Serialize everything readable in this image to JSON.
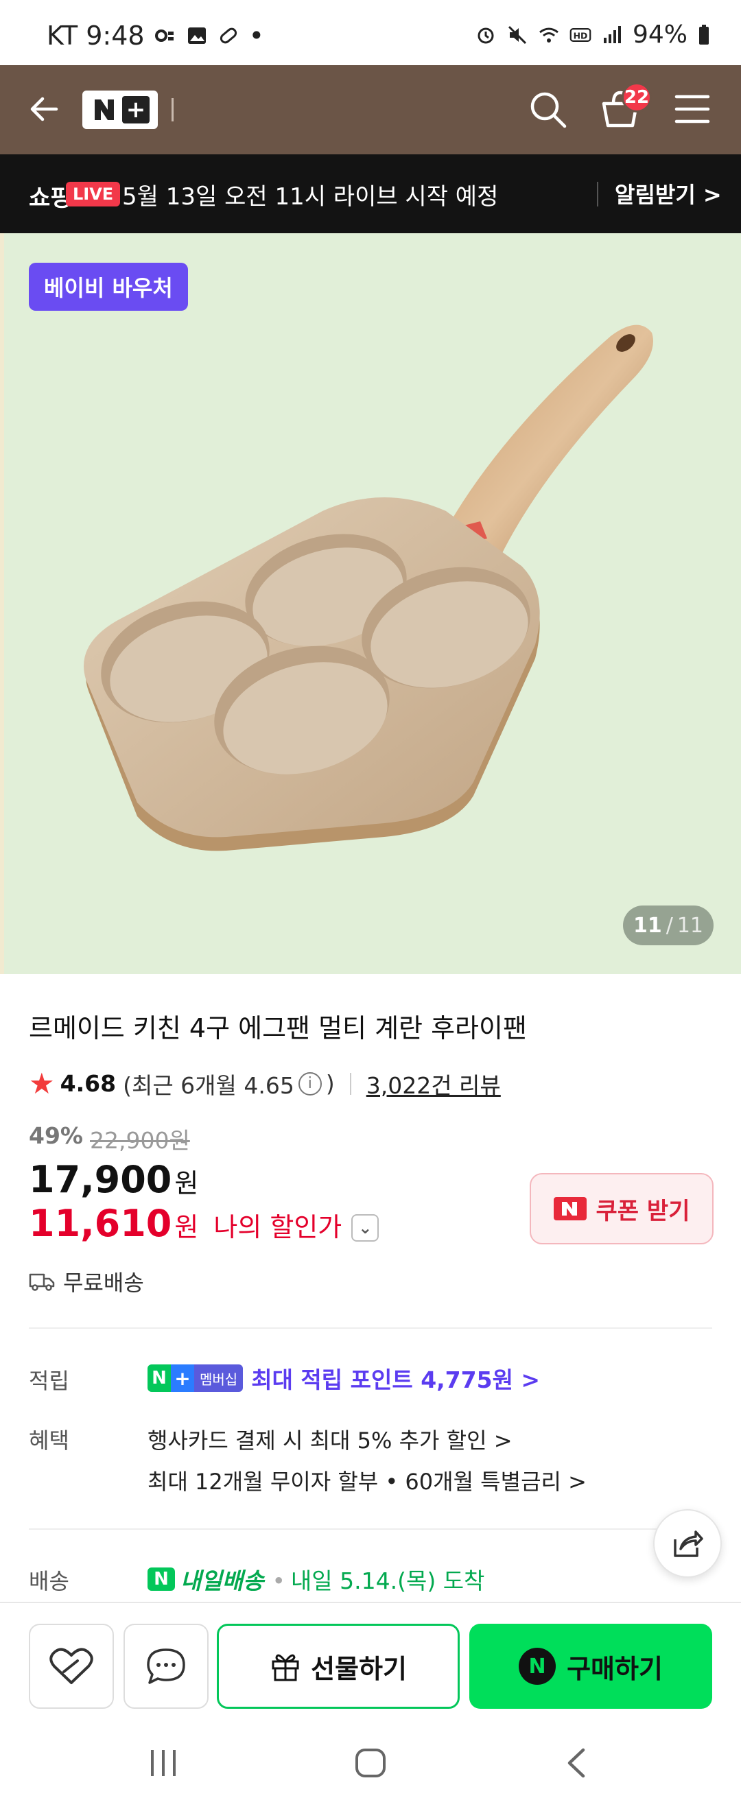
{
  "status_bar": {
    "carrier_time": "KT 9:48",
    "dot": "•",
    "battery": "94%"
  },
  "header": {
    "cart_count": "22"
  },
  "live_banner": {
    "shop_label": "쇼핑",
    "live_badge": "LIVE",
    "message": "5월 13일 오전 11시 라이브 시작 예정",
    "alarm_label": "알림받기 >"
  },
  "product_image": {
    "voucher_label": "베이비 바우처",
    "page_current": "11",
    "page_sep": "/",
    "page_total": "11"
  },
  "product": {
    "title": "르메이드 키친 4구 에그팬 멀티 계란 후라이팬",
    "rating": "4.68",
    "recent_rating_open": "(최근 6개월 4.65",
    "info_symbol": "i",
    "recent_rating_close": ")",
    "review_count": "3,022건 리뷰",
    "discount_pct": "49%",
    "original_price": "22,900원",
    "price": "17,900",
    "price_unit": "원",
    "my_price": "11,610",
    "my_price_unit": "원",
    "my_price_label": "나의 할인가",
    "coupon_button": "쿠폰 받기",
    "shipping_fee": "무료배송"
  },
  "membership": {
    "n": "N",
    "plus": "+",
    "tag": "멤버십"
  },
  "points": {
    "label": "적립",
    "text": "최대 적립 포인트 4,775원 >"
  },
  "benefits": {
    "label": "혜택",
    "line1": "행사카드 결제 시 최대 5% 추가 할인 >",
    "line2": "최대 12개월 무이자 할부 • 60개월 특별금리 >"
  },
  "delivery": {
    "label": "배송",
    "service": "내일배송",
    "dot": "•",
    "arrival": "내일 5.14.(목) 도착"
  },
  "bottom_bar": {
    "gift_label": "선물하기",
    "buy_label": "구매하기",
    "buy_icon": "N"
  }
}
